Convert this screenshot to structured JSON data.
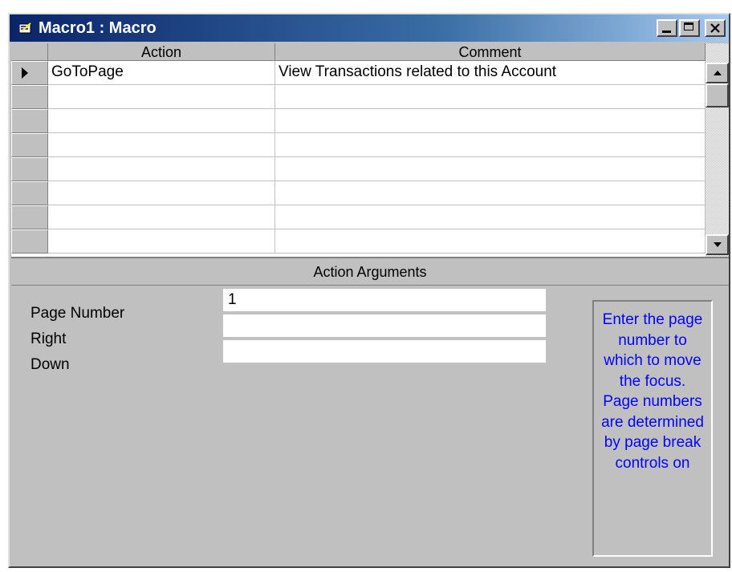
{
  "window": {
    "title": "Macro1 : Macro",
    "icons": [
      "macro-app-icon",
      "minimize-icon",
      "maximize-icon",
      "close-icon"
    ]
  },
  "grid": {
    "columns": [
      "Action",
      "Comment"
    ],
    "rows": [
      {
        "action": "GoToPage",
        "comment": "View Transactions related to this  Account"
      },
      {
        "action": "",
        "comment": ""
      },
      {
        "action": "",
        "comment": ""
      },
      {
        "action": "",
        "comment": ""
      },
      {
        "action": "",
        "comment": ""
      },
      {
        "action": "",
        "comment": ""
      },
      {
        "action": "",
        "comment": ""
      }
    ]
  },
  "arguments": {
    "header": "Action Arguments",
    "fields": [
      {
        "label": "Page Number",
        "value": "1"
      },
      {
        "label": "Right",
        "value": ""
      },
      {
        "label": "Down",
        "value": ""
      }
    ]
  },
  "help": {
    "text": "Enter the page number to which to move the focus. Page numbers are determined by page break controls on",
    "color": "#0000ff"
  },
  "colors": {
    "face": "#c0c0c0",
    "title_active": "#0a246a"
  }
}
